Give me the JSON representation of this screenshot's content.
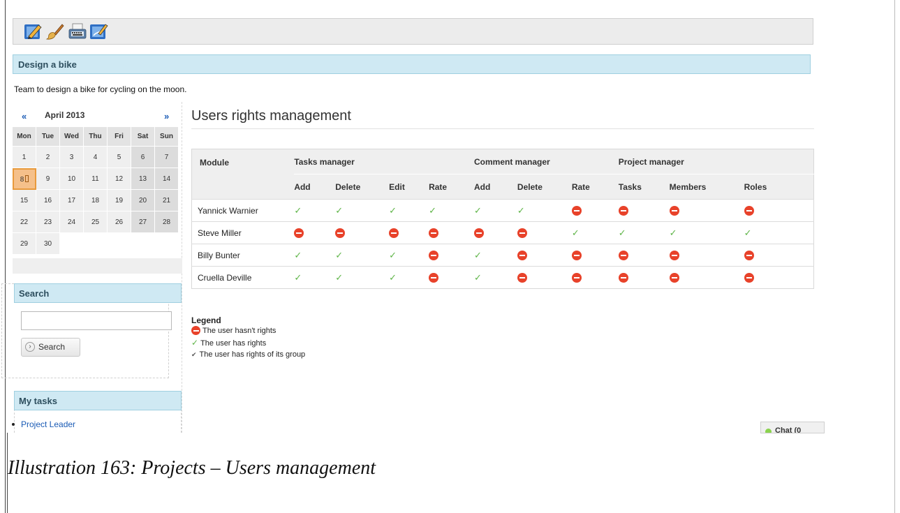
{
  "toolbar": {
    "icons": [
      "edit-project-icon",
      "brush-icon",
      "typewriter-icon",
      "edit-document-icon"
    ]
  },
  "project": {
    "name": "Design a bike",
    "description": "Team to design a bike for cycling on the moon."
  },
  "calendar": {
    "prev": "«",
    "next": "»",
    "month_title": "April 2013",
    "day_names": [
      "Mon",
      "Tue",
      "Wed",
      "Thu",
      "Fri",
      "Sat",
      "Sun"
    ],
    "weeks": [
      [
        "1",
        "2",
        "3",
        "4",
        "5",
        "6",
        "7"
      ],
      [
        "8",
        "9",
        "10",
        "11",
        "12",
        "13",
        "14"
      ],
      [
        "15",
        "16",
        "17",
        "18",
        "19",
        "20",
        "21"
      ],
      [
        "22",
        "23",
        "24",
        "25",
        "26",
        "27",
        "28"
      ],
      [
        "29",
        "30",
        "",
        "",
        "",
        "",
        ""
      ]
    ],
    "today": "8"
  },
  "search": {
    "heading": "Search",
    "value": "",
    "button_label": "Search"
  },
  "tasks": {
    "heading": "My tasks",
    "items": [
      "Project Leader"
    ]
  },
  "main": {
    "title": "Users rights management"
  },
  "rights_table": {
    "module_label": "Module",
    "groups": [
      "Tasks manager",
      "Comment manager",
      "Project manager"
    ],
    "columns": [
      "Add",
      "Delete",
      "Edit",
      "Rate",
      "Add",
      "Delete",
      "Rate",
      "Tasks",
      "Members",
      "Roles"
    ],
    "rows": [
      {
        "user": "Yannick Warnier",
        "rights": [
          "yes",
          "yes",
          "yes",
          "yes",
          "yes",
          "yes",
          "no",
          "no",
          "no",
          "no"
        ]
      },
      {
        "user": "Steve Miller",
        "rights": [
          "no",
          "no",
          "no",
          "no",
          "no",
          "no",
          "yes",
          "yes",
          "yes",
          "yes"
        ]
      },
      {
        "user": "Billy Bunter",
        "rights": [
          "yes",
          "yes",
          "yes",
          "no",
          "yes",
          "no",
          "no",
          "no",
          "no",
          "no"
        ]
      },
      {
        "user": "Cruella Deville",
        "rights": [
          "yes",
          "yes",
          "yes",
          "no",
          "yes",
          "no",
          "no",
          "no",
          "no",
          "no"
        ]
      }
    ],
    "colors": {
      "yes": "#5fb548",
      "no": "#e8422a"
    }
  },
  "legend": {
    "title": "Legend",
    "no_rights": "The user hasn't rights",
    "has_rights": "The user has rights",
    "group_rights": "The user has rights of its group"
  },
  "chat": {
    "label": "Chat (0"
  },
  "caption": "Illustration 163: Projects – Users management"
}
